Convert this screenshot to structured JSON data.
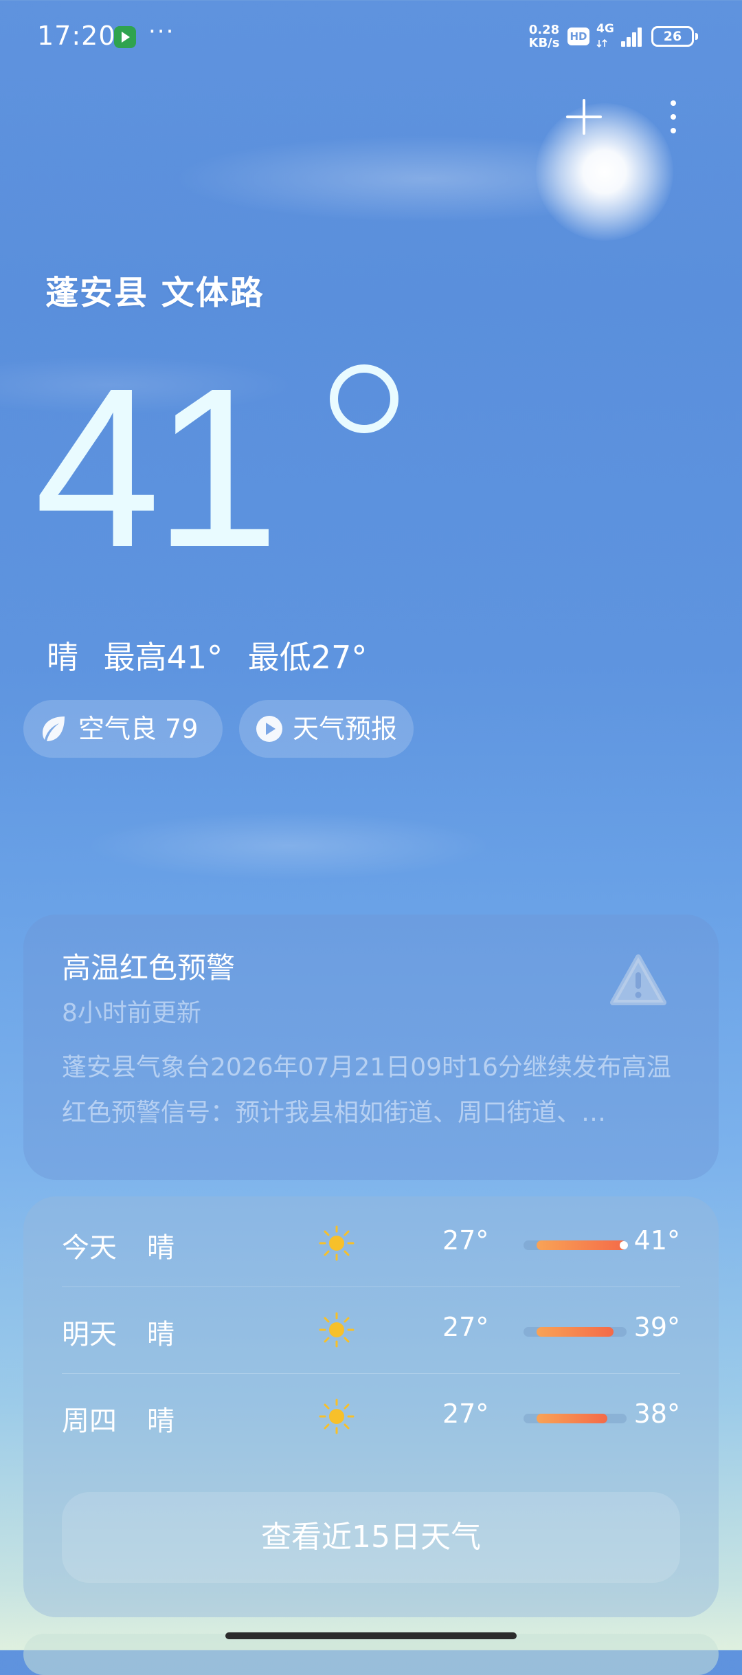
{
  "status_bar": {
    "time": "17:20",
    "dots": "···",
    "net_speed_value": "0.28",
    "net_speed_unit": "KB/s",
    "hd_badge": "HD",
    "network_type": "4G",
    "battery_level": "26"
  },
  "header": {
    "location": "蓬安县 文体路"
  },
  "current": {
    "temperature": "41",
    "condition": "晴",
    "high_text": "最高41°",
    "low_text": "最低27°"
  },
  "pills": {
    "aqi_label": "空气良",
    "aqi_value": "79",
    "forecast_label": "天气预报"
  },
  "warning": {
    "title": "高温红色预警",
    "updated": "8小时前更新",
    "body": "蓬安县气象台2026年07月21日09时16分继续发布高温红色预警信号：预计我县相如街道、周口街道、…"
  },
  "forecast": {
    "days": [
      {
        "day": "今天",
        "condition": "晴",
        "icon": "sun-icon",
        "low": "27°",
        "high": "41°",
        "low_value": 27,
        "high_value": 41,
        "current_value": 41
      },
      {
        "day": "明天",
        "condition": "晴",
        "icon": "sun-icon",
        "low": "27°",
        "high": "39°",
        "low_value": 27,
        "high_value": 39
      },
      {
        "day": "周四",
        "condition": "晴",
        "icon": "sun-icon",
        "low": "27°",
        "high": "38°",
        "low_value": 27,
        "high_value": 38
      }
    ],
    "range_min": 25,
    "range_max": 41,
    "more_button": "查看近15日天气"
  },
  "colors": {
    "sky_top": "#5f93de",
    "sky_bottom": "#dff0df",
    "sun_yellow": "#f7c02a",
    "temp_bar_start": "#f9a356",
    "temp_bar_end": "#f46a48"
  }
}
